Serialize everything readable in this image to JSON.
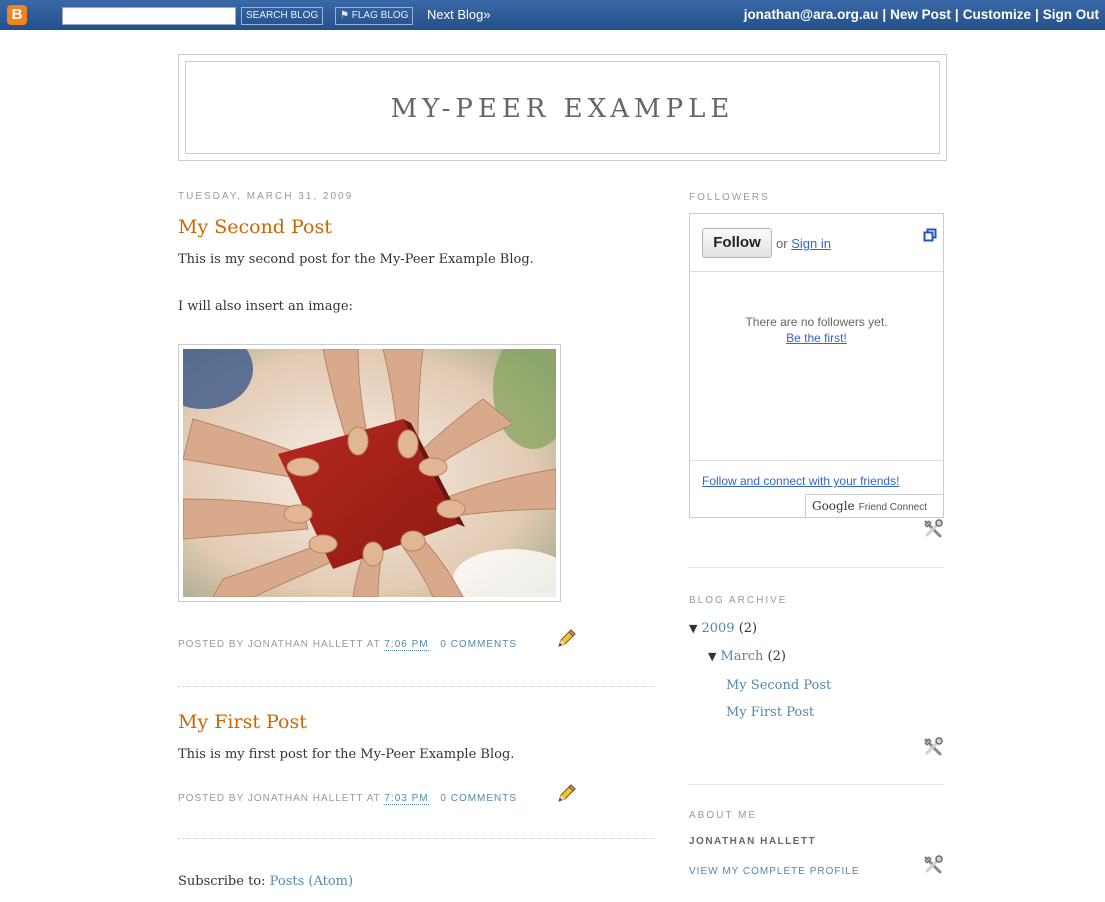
{
  "navbar": {
    "logo": "B",
    "search_value": "",
    "search_button": "SEARCH BLOG",
    "flag_button": "FLAG BLOG",
    "next_blog": "Next Blog»",
    "user_email": "jonathan@ara.org.au",
    "new_post": "New Post",
    "customize": "Customize",
    "sign_out": "Sign Out",
    "separator": "|"
  },
  "header": {
    "title": "MY-PEER EXAMPLE"
  },
  "posts": [
    {
      "date": "TUESDAY, MARCH 31, 2009",
      "title": "My Second Post",
      "body_line1": "This is my second post for the My-Peer Example Blog.",
      "body_line2": "I will also insert an image:",
      "footer_prefix": "POSTED BY JONATHAN HALLETT AT",
      "time": "7:06 PM",
      "comments": "0 COMMENTS"
    },
    {
      "title": "My First Post",
      "body_line1": "This is my first post for the My-Peer Example Blog.",
      "footer_prefix": "POSTED BY JONATHAN HALLETT AT",
      "time": "7:03 PM",
      "comments": "0 COMMENTS"
    }
  ],
  "subscribe": {
    "label": "Subscribe to:",
    "link": "Posts (Atom)"
  },
  "sidebar": {
    "followers": {
      "heading": "FOLLOWERS",
      "follow_button": "Follow",
      "or_text": "or",
      "sign_in": "Sign in",
      "empty_text": "There are no followers yet.",
      "be_first": "Be the first!",
      "connect_link": "Follow and connect with your friends!",
      "brand_google": "Google",
      "brand_text": "Friend Connect"
    },
    "archive": {
      "heading": "BLOG ARCHIVE",
      "year": "2009",
      "year_count": "(2)",
      "month": "March",
      "month_count": "(2)",
      "posts": [
        "My Second Post",
        "My First Post"
      ],
      "expanded_glyph": "▼"
    },
    "about": {
      "heading": "ABOUT ME",
      "name": "JONATHAN HALLETT",
      "profile_link": "VIEW MY COMPLETE PROFILE"
    }
  },
  "colors": {
    "navbar": "#2d5791",
    "title_orange": "#cc6600",
    "link_blue": "#5588aa",
    "gfc_blue": "#3366cc",
    "blogger_orange": "#f4821f"
  }
}
